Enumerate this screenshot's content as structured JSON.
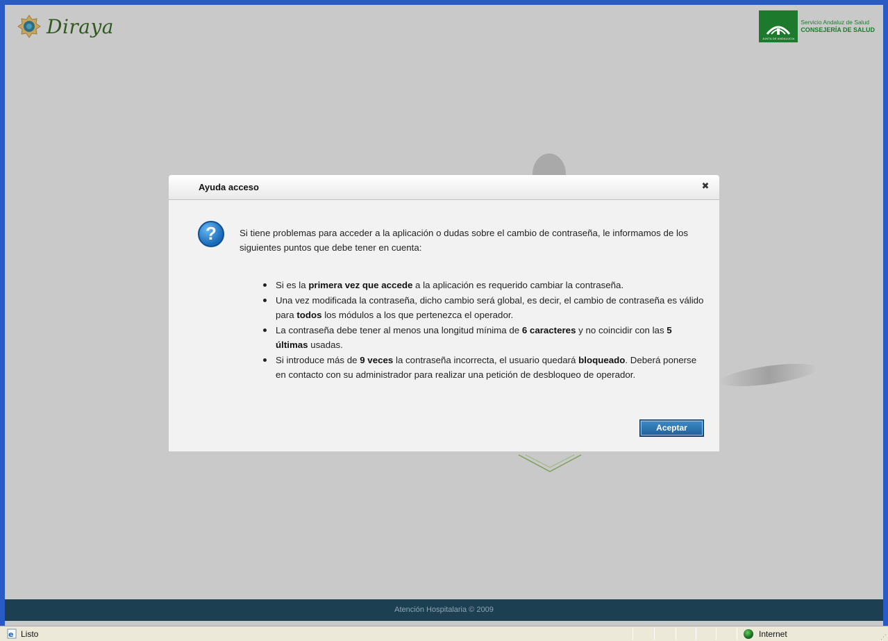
{
  "header": {
    "app_name": "Diraya",
    "sas_line1": "Servicio Andaluz de Salud",
    "sas_line2": "CONSEJERÍA DE SALUD",
    "sas_badge_text": "JUNTA DE ANDALUCIA"
  },
  "dialog": {
    "title": "Ayuda acceso",
    "close_glyph": "✖",
    "intro": "Si tiene problemas para acceder a la aplicación o dudas sobre el cambio de contraseña, le informamos de los siguientes puntos que debe tener en cuenta:",
    "bullets": [
      {
        "t1": "Si es la ",
        "b1": "primera vez que accede",
        "t2": " a la aplicación es requerido cambiar la contraseña."
      },
      {
        "t1": "Una vez modificada la contraseña, dicho cambio será global, es decir, el cambio de contraseña es válido para ",
        "b1": "todos",
        "t2": " los módulos a los que pertenezca el operador."
      },
      {
        "t1": "La contraseña debe tener al menos una longitud mínima de ",
        "b1": "6 caracteres",
        "t2": " y no coincidir con las ",
        "b2": "5 últimas",
        "t3": " usadas."
      },
      {
        "t1": "Si introduce más de ",
        "b1": "9 veces",
        "t2": " la contraseña incorrecta, el usuario quedará ",
        "b2": "bloqueado",
        "t3": ". Deberá ponerse en contacto con su administrador para realizar una petición de desbloqueo de operador."
      }
    ],
    "accept_label": "Aceptar"
  },
  "footer": {
    "text": "Atención Hospitalaria © 2009"
  },
  "statusbar": {
    "status": "Listo",
    "zone": "Internet"
  },
  "colors": {
    "footer_bg": "#1c3f52",
    "button_bg": "#1f5f97",
    "sas_green": "#1d7a2c"
  }
}
